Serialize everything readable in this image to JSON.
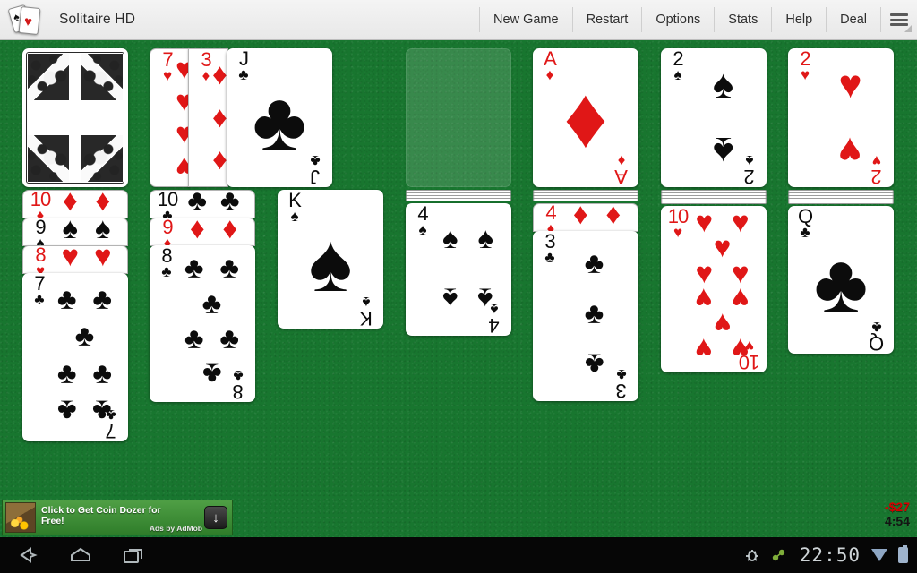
{
  "window": {
    "app_title": "Solitaire HD",
    "app_icon": "playing-cards-icon",
    "spade_glyph": "♠",
    "heart_glyph": "♥"
  },
  "menu": {
    "items": [
      {
        "label": "New Game",
        "name": "menu-new-game"
      },
      {
        "label": "Restart",
        "name": "menu-restart"
      },
      {
        "label": "Options",
        "name": "menu-options"
      },
      {
        "label": "Stats",
        "name": "menu-stats"
      },
      {
        "label": "Help",
        "name": "menu-help"
      },
      {
        "label": "Deal",
        "name": "menu-deal"
      }
    ],
    "overflow_icon": "hamburger-menu-icon"
  },
  "table": {
    "felt_color": "#18762f",
    "stock": {
      "state": "face-down",
      "label": "stock-pile"
    },
    "waste": {
      "cards": [
        {
          "rank": "7",
          "suit": "♥",
          "color": "red",
          "suit_name": "hearts"
        },
        {
          "rank": "3",
          "suit": "♦",
          "color": "red",
          "suit_name": "diamonds"
        },
        {
          "rank": "J",
          "suit": "♣",
          "color": "black",
          "suit_name": "clubs"
        }
      ]
    },
    "foundations": [
      {
        "empty": true,
        "label": "foundation-empty"
      },
      {
        "rank": "A",
        "suit": "♦",
        "color": "red",
        "suit_name": "diamonds"
      },
      {
        "rank": "2",
        "suit": "♠",
        "color": "black",
        "suit_name": "spades"
      },
      {
        "rank": "2",
        "suit": "♥",
        "color": "red",
        "suit_name": "hearts"
      }
    ],
    "tableau": [
      {
        "facedown": 0,
        "cards": [
          {
            "rank": "10",
            "suit": "♦",
            "color": "red",
            "suit_name": "diamonds"
          },
          {
            "rank": "9",
            "suit": "♠",
            "color": "black",
            "suit_name": "spades"
          },
          {
            "rank": "8",
            "suit": "♥",
            "color": "red",
            "suit_name": "hearts"
          },
          {
            "rank": "7",
            "suit": "♣",
            "color": "black",
            "suit_name": "clubs"
          }
        ]
      },
      {
        "facedown": 0,
        "cards": [
          {
            "rank": "10",
            "suit": "♣",
            "color": "black",
            "suit_name": "clubs"
          },
          {
            "rank": "9",
            "suit": "♦",
            "color": "red",
            "suit_name": "diamonds"
          },
          {
            "rank": "8",
            "suit": "♣",
            "color": "black",
            "suit_name": "clubs"
          }
        ]
      },
      {
        "facedown": 0,
        "cards": [
          {
            "rank": "K",
            "suit": "♠",
            "color": "black",
            "suit_name": "spades"
          }
        ]
      },
      {
        "facedown": 4,
        "cards": [
          {
            "rank": "4",
            "suit": "♠",
            "color": "black",
            "suit_name": "spades"
          }
        ]
      },
      {
        "facedown": 4,
        "cards": [
          {
            "rank": "4",
            "suit": "♦",
            "color": "red",
            "suit_name": "diamonds"
          },
          {
            "rank": "3",
            "suit": "♣",
            "color": "black",
            "suit_name": "clubs"
          }
        ]
      },
      {
        "facedown": 5,
        "cards": [
          {
            "rank": "10",
            "suit": "♥",
            "color": "red",
            "suit_name": "hearts"
          }
        ]
      },
      {
        "facedown": 5,
        "cards": [
          {
            "rank": "Q",
            "suit": "♣",
            "color": "black",
            "suit_name": "clubs"
          }
        ]
      }
    ]
  },
  "ad": {
    "headline": "Click to Get Coin Dozer for",
    "headline2": "Free!",
    "attribution": "Ads by AdMob",
    "download_icon": "download-arrow-icon",
    "thumb_name": "coin-dozer-thumbnail"
  },
  "status": {
    "score": "-$27",
    "score_color": "#d40000",
    "time": "4:54"
  },
  "systembar": {
    "back_icon": "back-arrow-icon",
    "home_icon": "home-icon",
    "recents_icon": "recent-apps-icon",
    "debug_icon": "usb-debug-icon",
    "usb_icon": "usb-connected-icon",
    "clock": "22:50",
    "wifi_icon": "wifi-icon",
    "battery_icon": "battery-icon"
  }
}
